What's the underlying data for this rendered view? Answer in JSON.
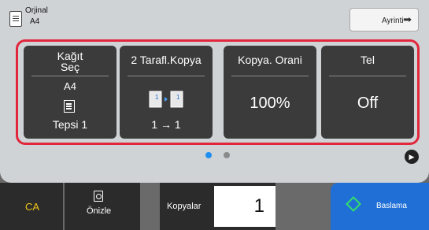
{
  "header": {
    "original_label": "Orjinal",
    "original_size": "A4",
    "details_button": "Ayrinti",
    "details_icon": "arrow-right-icon"
  },
  "tiles": [
    {
      "title": "Kağıt\nSeç",
      "value": "A4",
      "icon": "tray-icon",
      "sub": "Tepsi 1"
    },
    {
      "title": "2 Tarafl.Kopya",
      "icon": "duplex-copy-icon",
      "sub": "1 → 1"
    },
    {
      "title": "Kopya. Orani",
      "value": "100%"
    },
    {
      "title": "Tel",
      "value": "Off"
    }
  ],
  "pager": {
    "pages": 2,
    "active": 1
  },
  "footer": {
    "clear_all": "CA",
    "preview": "Önizle",
    "copies_label": "Kopyalar",
    "copies_value": "1",
    "start": "Baslama"
  },
  "colors": {
    "accent_red": "#e2263b",
    "tile_bg": "#3b3b3b",
    "start_blue": "#1f6fd6",
    "ca_yellow": "#f0c419",
    "dot_active": "#1f8ef1",
    "dot_inactive": "#8a8a8a"
  }
}
